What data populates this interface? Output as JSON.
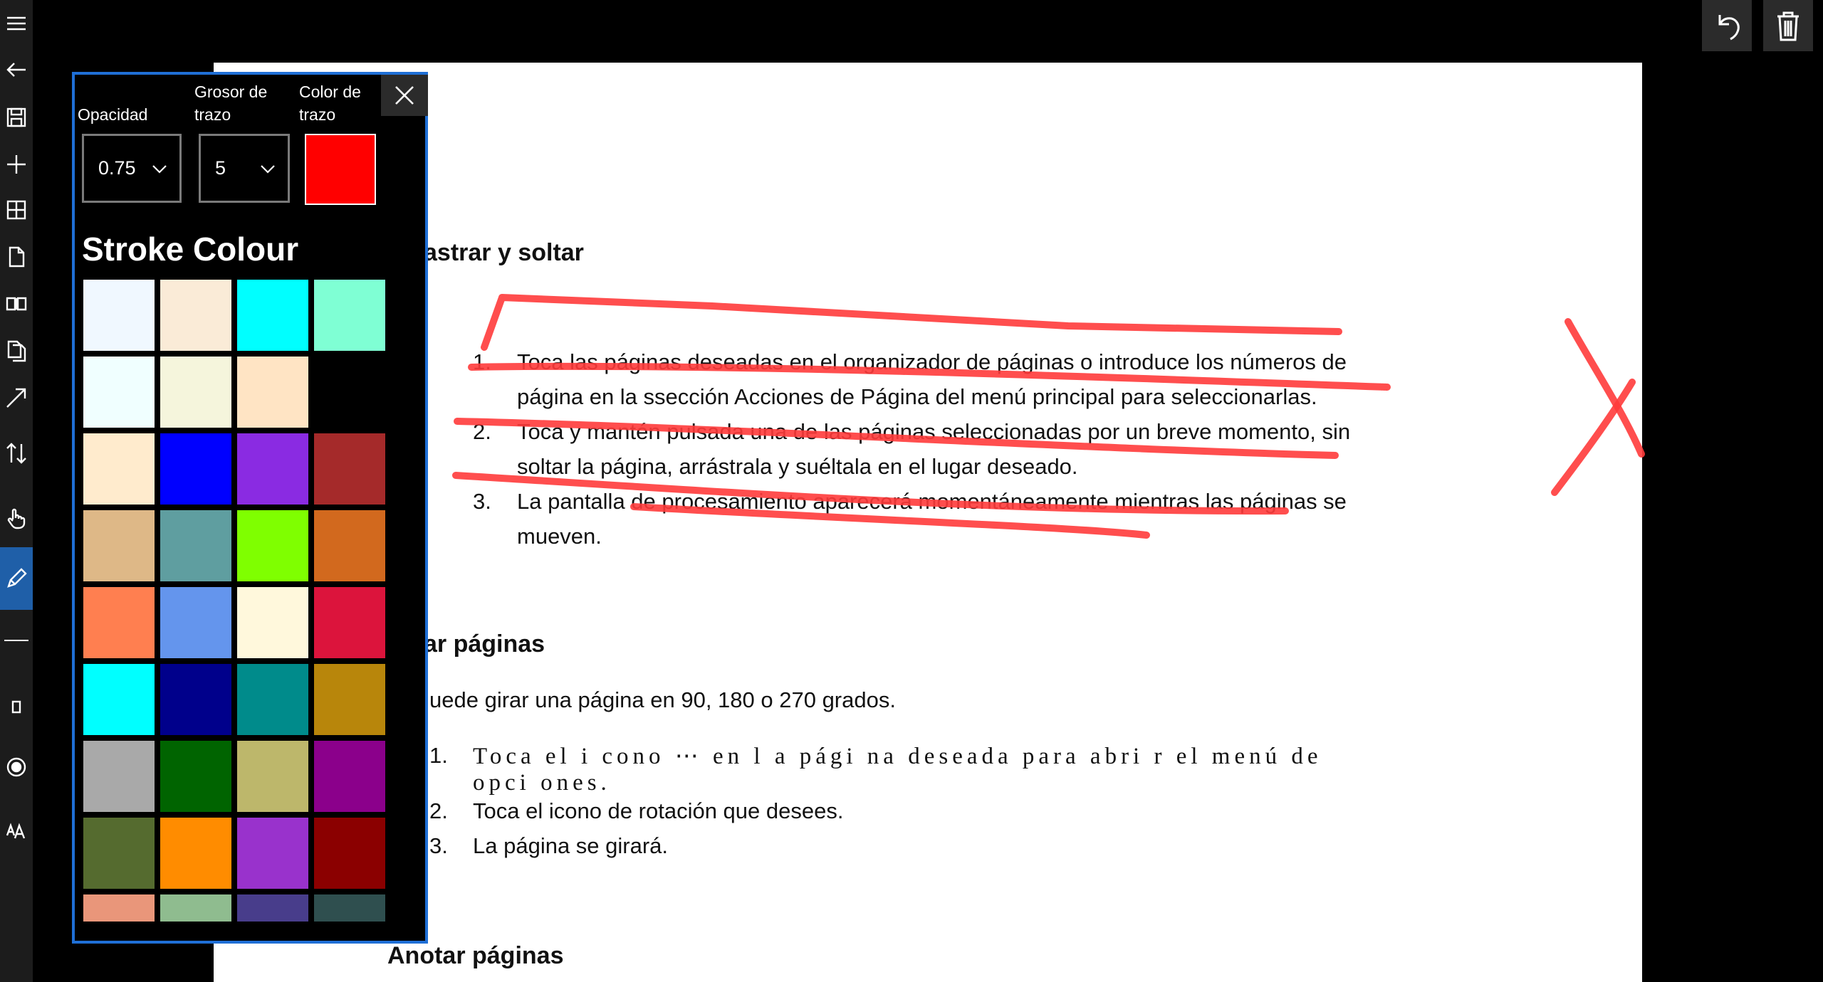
{
  "panel": {
    "opacity_label": "Opacidad",
    "thickness_label": "Grosor de trazo",
    "color_label": "Color de trazo",
    "opacity_value": "0.75",
    "thickness_value": "5",
    "current_color": "#ff0000",
    "title": "Stroke Colour",
    "swatches": [
      "#f0f8ff",
      "#faebd7",
      "#00ffff",
      "#7fffd4",
      "#f0ffff",
      "#f5f5dc",
      "#ffe4c4",
      "",
      "#ffebcd",
      "#0000ff",
      "#8a2be2",
      "#a52a2a",
      "#deb887",
      "#5f9ea0",
      "#7fff00",
      "#d2691e",
      "#ff7f50",
      "#6495ed",
      "#fff8dc",
      "#dc143c",
      "#00ffff",
      "#00008b",
      "#008b8b",
      "#b8860b",
      "#a9a9a9",
      "#006400",
      "#bdb76b",
      "#8b008b",
      "#556b2f",
      "#ff8c00",
      "#9932cc",
      "#8b0000",
      "#e9967a",
      "#8fbc8f",
      "#483d8b",
      "#2f4f4f"
    ]
  },
  "document": {
    "heading1": "astrar y soltar",
    "list1": [
      {
        "num": "1.",
        "lines": [
          "Toca las páginas deseadas en el organizador de páginas o introduce los números de",
          "página en la ssección Acciones de Página del menú principal para seleccionarlas."
        ]
      },
      {
        "num": "2.",
        "lines": [
          "Toca y mantén pulsada una de las páginas seleccionadas por un breve momento, sin",
          "soltar la página, arrástrala y suéltala en el lugar deseado."
        ]
      },
      {
        "num": "3.",
        "lines": [
          "La pantalla de procesamiento aparecerá momentáneamente mientras las páginas se",
          "mueven."
        ]
      }
    ],
    "heading2": "ar páginas",
    "para2": "uede girar una página en 90, 180 o 270 grados.",
    "list2": [
      {
        "num": "1.",
        "lines": [
          "Toca el  i cono ⋯ en l a  pági na  deseada para abri r  el  menú de",
          "opci ones."
        ]
      },
      {
        "num": "2.",
        "lines": [
          "Toca el icono de rotación que desees."
        ]
      },
      {
        "num": "3.",
        "lines": [
          "La página se girará."
        ]
      }
    ],
    "heading3": "Anotar páginas"
  },
  "colors": {
    "accent": "#1f6fd6",
    "ink": "#ff3b3b",
    "sidebar_active": "#1f5fa8"
  }
}
